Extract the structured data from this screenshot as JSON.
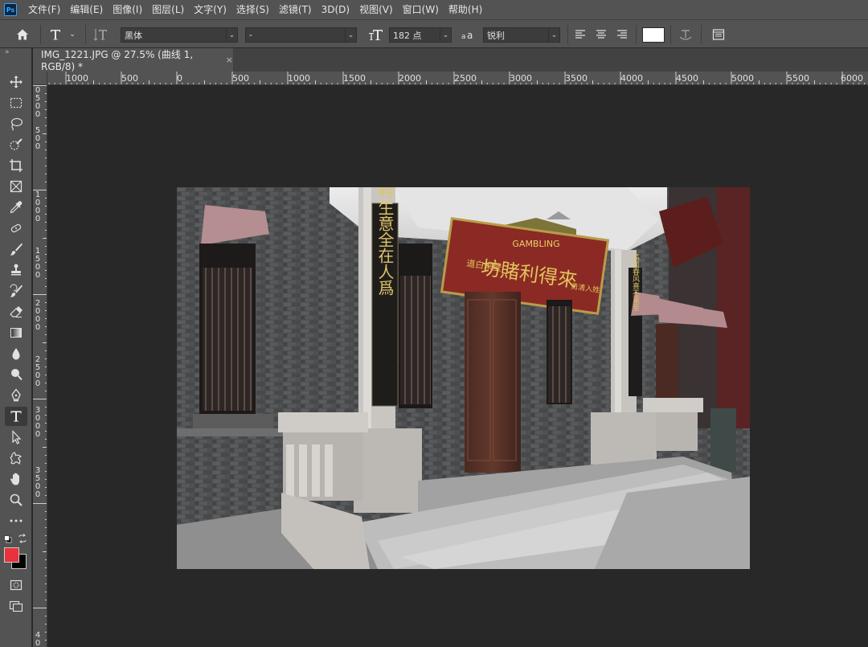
{
  "menu": {
    "app_icon": "Ps",
    "items": [
      "文件(F)",
      "编辑(E)",
      "图像(I)",
      "图层(L)",
      "文字(Y)",
      "选择(S)",
      "滤镜(T)",
      "3D(D)",
      "视图(V)",
      "窗口(W)",
      "帮助(H)"
    ]
  },
  "options": {
    "font_family": "黑体",
    "font_style": "-",
    "font_size": "182 点",
    "antialias": "锐利",
    "text_color": "#ffffff"
  },
  "document": {
    "tab_title": "IMG_1221.JPG @ 27.5% (曲线 1, RGB/8) *",
    "close": "×"
  },
  "ruler": {
    "h_labels": [
      "1000",
      "500",
      "0",
      "500",
      "1000",
      "1500",
      "2000",
      "2500",
      "3000",
      "3500",
      "4000",
      "4500",
      "5000",
      "5500",
      "6000"
    ],
    "v_labels": [
      "0",
      "5",
      "0",
      "0",
      "5",
      "0",
      "0",
      "1",
      "0",
      "0",
      "0",
      "1",
      "5",
      "0",
      "0",
      "2",
      "0",
      "0",
      "0",
      "2",
      "5",
      "0",
      "0",
      "3",
      "0",
      "0",
      "0",
      "3",
      "5",
      "0",
      "0",
      "4",
      "0"
    ]
  },
  "toolbar": {
    "collapse": "»",
    "tools": [
      "move-tool",
      "marquee-tool",
      "lasso-tool",
      "quick-select-tool",
      "crop-tool",
      "frame-tool",
      "eyedropper-tool",
      "healing-brush-tool",
      "brush-tool",
      "clone-stamp-tool",
      "history-brush-tool",
      "eraser-tool",
      "gradient-tool",
      "blur-tool",
      "dodge-tool",
      "pen-tool",
      "type-tool",
      "path-select-tool",
      "shape-tool",
      "hand-tool",
      "zoom-tool",
      "more-tools"
    ],
    "foreground_color": "#e8323c",
    "background_color": "#000000"
  },
  "photo": {
    "signboard_en": "GAMBLING",
    "signboard_cn": "坊賭利得來",
    "sign_left": "道白来壁",
    "sign_right": "勇清入姓",
    "couplet_left": "四時生意全在人爲",
    "couplet_right": "高面春风喜丕來至"
  }
}
